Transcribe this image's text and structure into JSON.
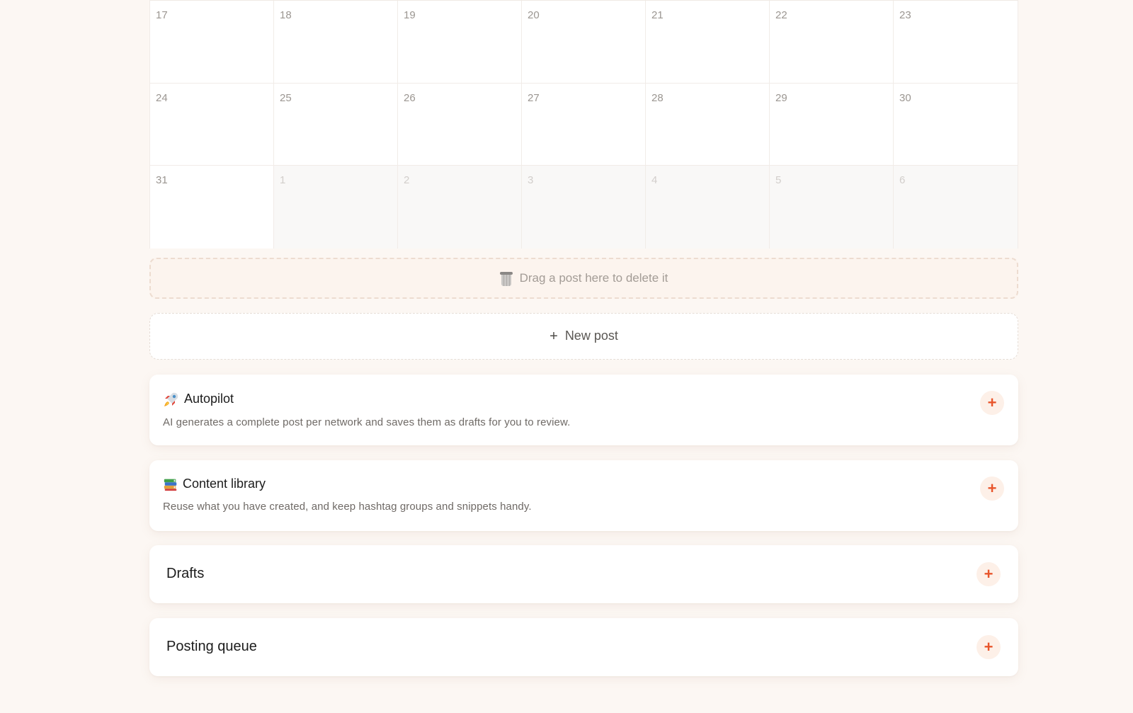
{
  "calendar": {
    "rows": [
      [
        {
          "day": "17"
        },
        {
          "day": "18"
        },
        {
          "day": "19"
        },
        {
          "day": "20"
        },
        {
          "day": "21"
        },
        {
          "day": "22"
        },
        {
          "day": "23"
        }
      ],
      [
        {
          "day": "24"
        },
        {
          "day": "25"
        },
        {
          "day": "26"
        },
        {
          "day": "27"
        },
        {
          "day": "28"
        },
        {
          "day": "29"
        },
        {
          "day": "30"
        }
      ],
      [
        {
          "day": "31"
        },
        {
          "day": "1",
          "other_month": true
        },
        {
          "day": "2",
          "other_month": true
        },
        {
          "day": "3",
          "other_month": true
        },
        {
          "day": "4",
          "other_month": true
        },
        {
          "day": "5",
          "other_month": true
        },
        {
          "day": "6",
          "other_month": true
        }
      ]
    ]
  },
  "drop_zone": {
    "icon": "trash-icon",
    "label": "Drag a post here to delete it"
  },
  "new_post": {
    "icon": "plus-icon",
    "label": "New post"
  },
  "cards": {
    "autopilot": {
      "icon": "rocket-icon",
      "title": "Autopilot",
      "description": "AI generates a complete post per network and saves them as drafts for you to review."
    },
    "content_library": {
      "icon": "books-icon",
      "title": "Content library",
      "description": "Reuse what you have created, and keep hashtag groups and snippets handy."
    },
    "drafts": {
      "title": "Drafts"
    },
    "posting_queue": {
      "title": "Posting queue"
    }
  },
  "colors": {
    "page_background": "#fcf7f3",
    "accent": "#e8552b",
    "accent_soft": "#fdf0e8"
  }
}
